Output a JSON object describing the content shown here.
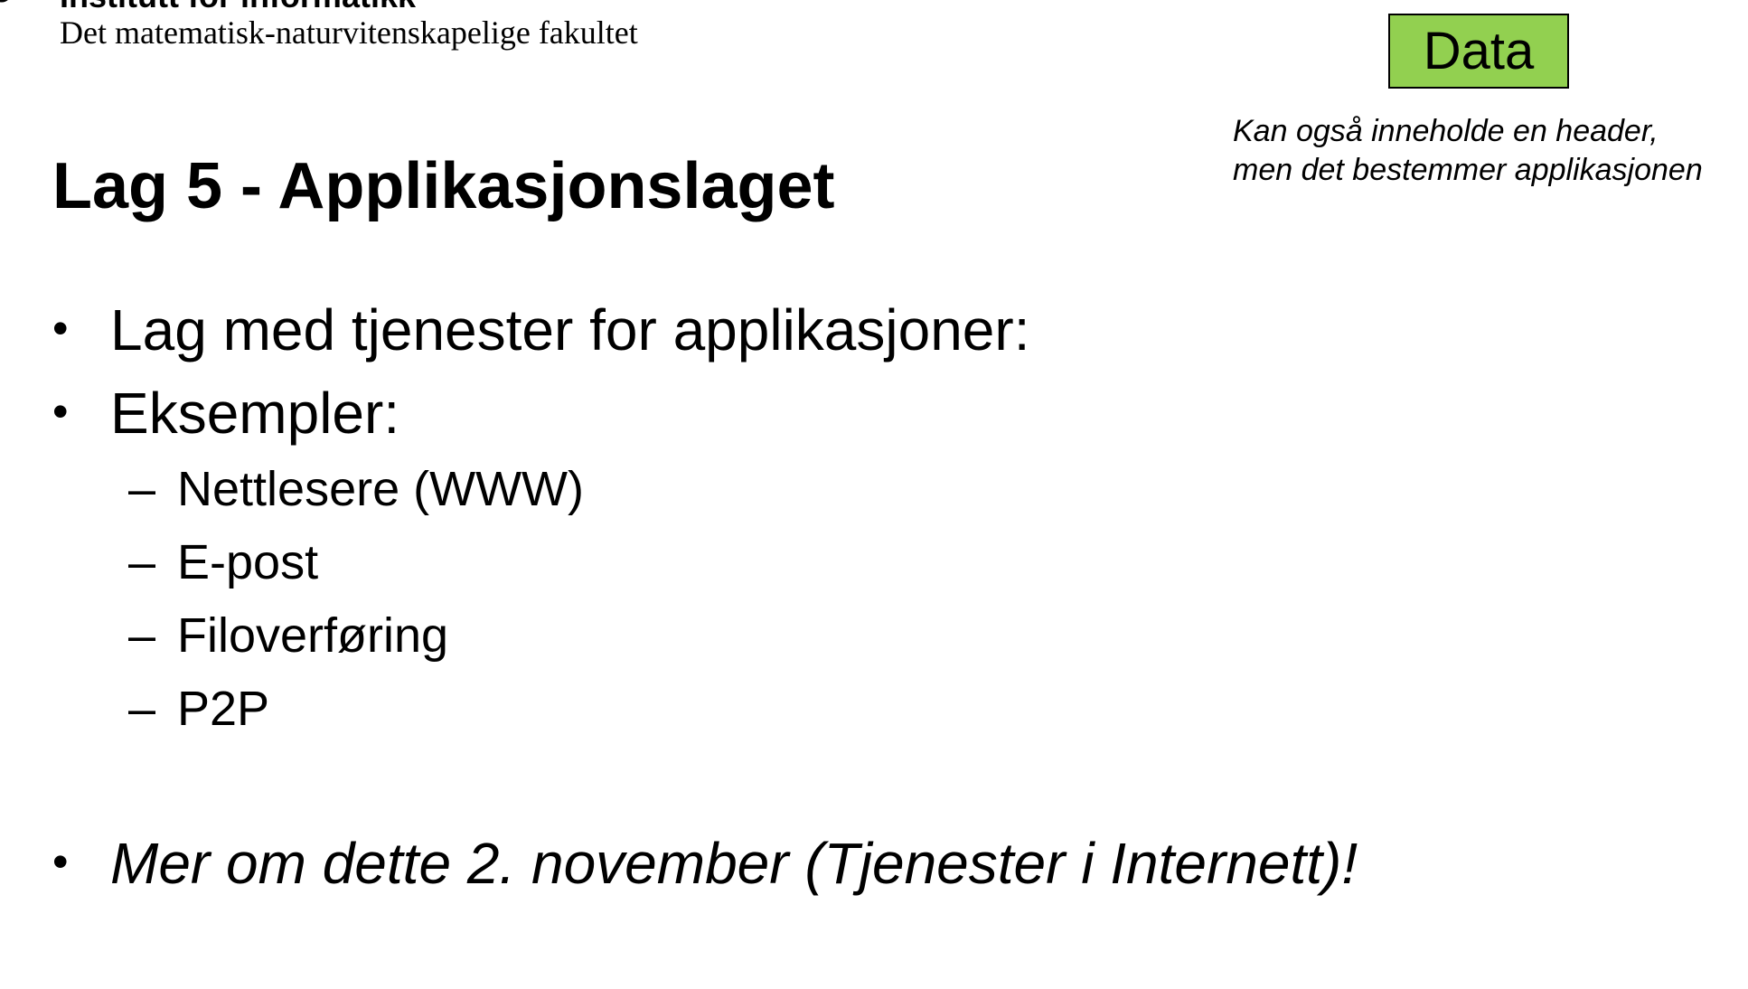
{
  "header": {
    "institute": "Institutt for informatikk",
    "faculty": "Det matematisk-naturvitenskapelige fakultet"
  },
  "diagram": {
    "data_box_label": "Data",
    "data_box_color": "#92d050",
    "note_lines": [
      "Kan også inneholde en header,",
      "men det bestemmer applikasjonen"
    ]
  },
  "slide": {
    "title": "Lag 5 - Applikasjonslaget",
    "bullet_symbol": "•",
    "dash_symbol": "–",
    "bullets": [
      "Lag med tjenester for applikasjoner:",
      "Eksempler:"
    ],
    "sub_items": [
      "Nettlesere (WWW)",
      "E-post",
      "Filoverføring",
      "P2P"
    ],
    "final_bullet": "Mer om dette 2. november (Tjenester i Internett)!"
  },
  "colors": {
    "logo_red": "#d9232a",
    "text": "#000000",
    "background": "#ffffff"
  }
}
